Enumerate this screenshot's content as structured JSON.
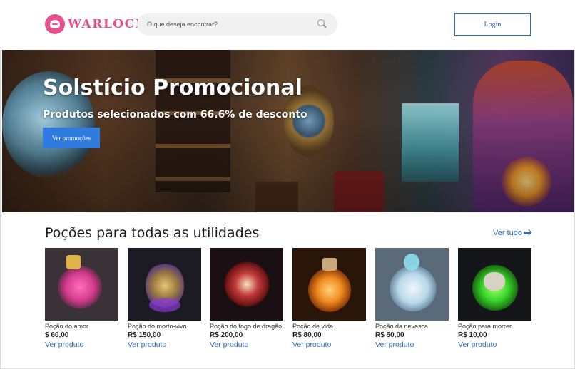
{
  "header": {
    "logo_text": "WARLOCK",
    "search": {
      "placeholder": "O que deseja encontrar?"
    },
    "login_label": "Login"
  },
  "hero": {
    "title": "Solstício Promocional",
    "subtitle": "Produtos selecionados com 66.6% de desconto",
    "button_label": "Ver promoções"
  },
  "section": {
    "title": "Poções para todas as utilidades",
    "see_all_label": "Ver tudo"
  },
  "products": [
    {
      "name": "Poção do amor",
      "price": "$ 60,00",
      "link": "Ver produto"
    },
    {
      "name": "Poção do morto-vivo",
      "price": "R$ 150,00",
      "link": "Ver produto"
    },
    {
      "name": "Poção do fogo de dragão",
      "price": "R$ 200,00",
      "link": "Ver produto"
    },
    {
      "name": "Poção de vida",
      "price": "R$ 80,00",
      "link": "Ver produto"
    },
    {
      "name": "Poção da nevasca",
      "price": "R$ 60,00",
      "link": "Ver produto"
    },
    {
      "name": "Poção para morrer",
      "price": "R$ 10,00",
      "link": "Ver produto"
    }
  ],
  "colors": {
    "brand_pink": "#e7508e",
    "accent_blue": "#2f6fc9",
    "button_blue": "#2f7be0"
  }
}
